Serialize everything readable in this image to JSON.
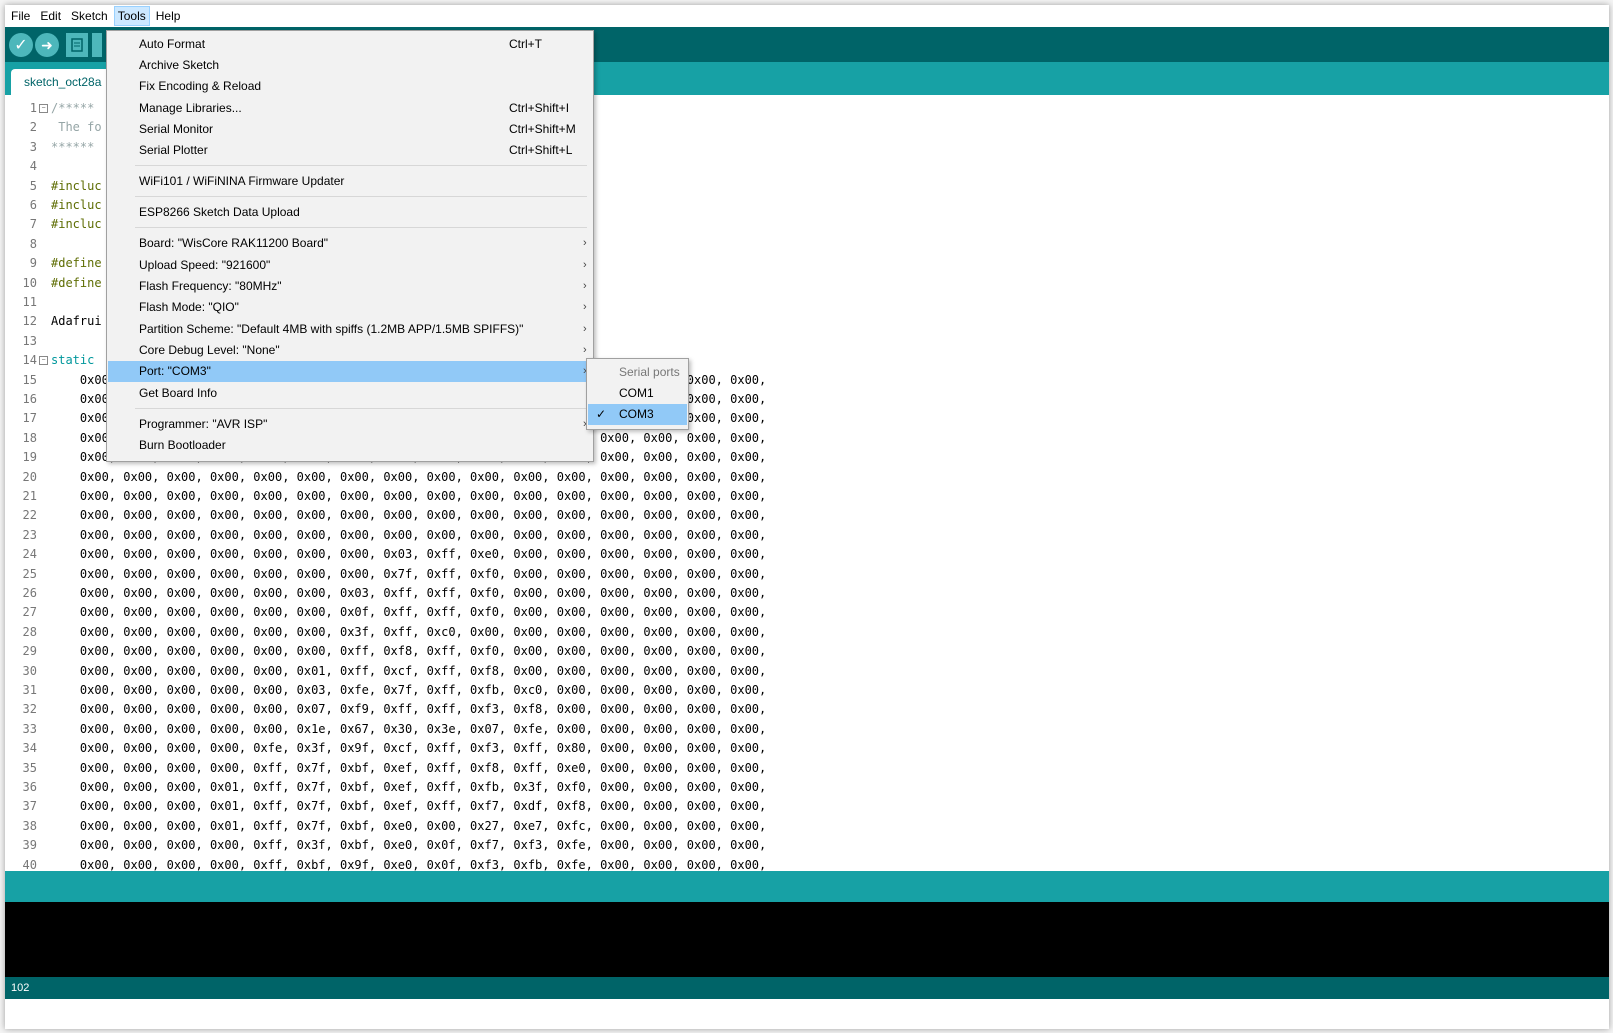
{
  "menubar": {
    "items": [
      "File",
      "Edit",
      "Sketch",
      "Tools",
      "Help"
    ]
  },
  "tab": {
    "label": "sketch_oct28a"
  },
  "editor": {
    "line_numbers": [
      "1",
      "2",
      "3",
      "4",
      "5",
      "6",
      "7",
      "8",
      "9",
      "10",
      "11",
      "12",
      "13",
      "14",
      "15",
      "16",
      "17",
      "18",
      "19",
      "20",
      "21",
      "22",
      "23",
      "24",
      "25",
      "26",
      "27",
      "28",
      "29",
      "30",
      "31",
      "32",
      "33",
      "34",
      "35",
      "36",
      "37",
      "38",
      "39",
      "40"
    ],
    "code_lines": [
      "/*****",
      " The fo",
      "******",
      "",
      "#incluc",
      "#incluc",
      "#incluc",
      "",
      "#define",
      "#define",
      "",
      "Adafrui",
      "",
      "static",
      "    0x00, 0x00, 0x00, 0x00, 0x00, 0x00, 0x00, 0x00, 0x00, 0x00, 0x00, 0x00, 0x00, 0x00, 0x00, 0x00,",
      "    0x00, 0x00, 0x00, 0x00, 0x00, 0x00, 0x00, 0x00, 0x00, 0x00, 0x00, 0x00, 0x00, 0x00, 0x00, 0x00,",
      "    0x00, 0x00, 0x00, 0x00, 0x00, 0x00, 0x00, 0x00, 0x00, 0x00, 0x00, 0x00, 0x00, 0x00, 0x00, 0x00,",
      "    0x00, 0x00, 0x00, 0x00, 0x00, 0x00, 0x00, 0x00, 0x00, 0x00, 0x00, 0x00, 0x00, 0x00, 0x00, 0x00,",
      "    0x00, 0x00, 0x00, 0x00, 0x00, 0x00, 0x00, 0x00, 0x00, 0x00, 0x00, 0x00, 0x00, 0x00, 0x00, 0x00,",
      "    0x00, 0x00, 0x00, 0x00, 0x00, 0x00, 0x00, 0x00, 0x00, 0x00, 0x00, 0x00, 0x00, 0x00, 0x00, 0x00,",
      "    0x00, 0x00, 0x00, 0x00, 0x00, 0x00, 0x00, 0x00, 0x00, 0x00, 0x00, 0x00, 0x00, 0x00, 0x00, 0x00,",
      "    0x00, 0x00, 0x00, 0x00, 0x00, 0x00, 0x00, 0x00, 0x00, 0x00, 0x00, 0x00, 0x00, 0x00, 0x00, 0x00,",
      "    0x00, 0x00, 0x00, 0x00, 0x00, 0x00, 0x00, 0x00, 0x00, 0x00, 0x00, 0x00, 0x00, 0x00, 0x00, 0x00,",
      "    0x00, 0x00, 0x00, 0x00, 0x00, 0x00, 0x00, 0x03, 0xff, 0xe0, 0x00, 0x00, 0x00, 0x00, 0x00, 0x00,",
      "    0x00, 0x00, 0x00, 0x00, 0x00, 0x00, 0x00, 0x7f, 0xff, 0xf0, 0x00, 0x00, 0x00, 0x00, 0x00, 0x00,",
      "    0x00, 0x00, 0x00, 0x00, 0x00, 0x00, 0x03, 0xff, 0xff, 0xf0, 0x00, 0x00, 0x00, 0x00, 0x00, 0x00,",
      "    0x00, 0x00, 0x00, 0x00, 0x00, 0x00, 0x0f, 0xff, 0xff, 0xf0, 0x00, 0x00, 0x00, 0x00, 0x00, 0x00,",
      "    0x00, 0x00, 0x00, 0x00, 0x00, 0x00, 0x3f, 0xff, 0xc0, 0x00, 0x00, 0x00, 0x00, 0x00, 0x00, 0x00,",
      "    0x00, 0x00, 0x00, 0x00, 0x00, 0x00, 0xff, 0xf8, 0xff, 0xf0, 0x00, 0x00, 0x00, 0x00, 0x00, 0x00,",
      "    0x00, 0x00, 0x00, 0x00, 0x00, 0x01, 0xff, 0xcf, 0xff, 0xf8, 0x00, 0x00, 0x00, 0x00, 0x00, 0x00,",
      "    0x00, 0x00, 0x00, 0x00, 0x00, 0x03, 0xfe, 0x7f, 0xff, 0xfb, 0xc0, 0x00, 0x00, 0x00, 0x00, 0x00,",
      "    0x00, 0x00, 0x00, 0x00, 0x00, 0x07, 0xf9, 0xff, 0xff, 0xf3, 0xf8, 0x00, 0x00, 0x00, 0x00, 0x00,",
      "    0x00, 0x00, 0x00, 0x00, 0x00, 0x1e, 0x67, 0x30, 0x3e, 0x07, 0xfe, 0x00, 0x00, 0x00, 0x00, 0x00,",
      "    0x00, 0x00, 0x00, 0x00, 0xfe, 0x3f, 0x9f, 0xcf, 0xff, 0xf3, 0xff, 0x80, 0x00, 0x00, 0x00, 0x00,",
      "    0x00, 0x00, 0x00, 0x00, 0xff, 0x7f, 0xbf, 0xef, 0xff, 0xf8, 0xff, 0xe0, 0x00, 0x00, 0x00, 0x00,",
      "    0x00, 0x00, 0x00, 0x01, 0xff, 0x7f, 0xbf, 0xef, 0xff, 0xfb, 0x3f, 0xf0, 0x00, 0x00, 0x00, 0x00,",
      "    0x00, 0x00, 0x00, 0x01, 0xff, 0x7f, 0xbf, 0xef, 0xff, 0xf7, 0xdf, 0xf8, 0x00, 0x00, 0x00, 0x00,",
      "    0x00, 0x00, 0x00, 0x01, 0xff, 0x7f, 0xbf, 0xe0, 0x00, 0x27, 0xe7, 0xfc, 0x00, 0x00, 0x00, 0x00,",
      "    0x00, 0x00, 0x00, 0x00, 0xff, 0x3f, 0xbf, 0xe0, 0x0f, 0xf7, 0xf3, 0xfe, 0x00, 0x00, 0x00, 0x00,",
      "    0x00, 0x00, 0x00, 0x00, 0xff, 0xbf, 0x9f, 0xe0, 0x0f, 0xf3, 0xfb, 0xfe, 0x00, 0x00, 0x00, 0x00,"
    ]
  },
  "tools_menu": {
    "items": [
      {
        "label": "Auto Format",
        "shortcut": "Ctrl+T"
      },
      {
        "label": "Archive Sketch",
        "shortcut": ""
      },
      {
        "label": "Fix Encoding & Reload",
        "shortcut": ""
      },
      {
        "label": "Manage Libraries...",
        "shortcut": "Ctrl+Shift+I"
      },
      {
        "label": "Serial Monitor",
        "shortcut": "Ctrl+Shift+M"
      },
      {
        "label": "Serial Plotter",
        "shortcut": "Ctrl+Shift+L"
      },
      {
        "label": "WiFi101 / WiFiNINA Firmware Updater",
        "shortcut": ""
      },
      {
        "label": "ESP8266 Sketch Data Upload",
        "shortcut": ""
      },
      {
        "label": "Board: \"WisCore RAK11200 Board\"",
        "shortcut": ""
      },
      {
        "label": "Upload Speed: \"921600\"",
        "shortcut": ""
      },
      {
        "label": "Flash Frequency: \"80MHz\"",
        "shortcut": ""
      },
      {
        "label": "Flash Mode: \"QIO\"",
        "shortcut": ""
      },
      {
        "label": "Partition Scheme: \"Default 4MB with spiffs (1.2MB APP/1.5MB SPIFFS)\"",
        "shortcut": ""
      },
      {
        "label": "Core Debug Level: \"None\"",
        "shortcut": ""
      },
      {
        "label": "Port: \"COM3\"",
        "shortcut": ""
      },
      {
        "label": "Get Board Info",
        "shortcut": ""
      },
      {
        "label": "Programmer: \"AVR ISP\"",
        "shortcut": ""
      },
      {
        "label": "Burn Bootloader",
        "shortcut": ""
      }
    ],
    "submenu_arrow": "›"
  },
  "port_submenu": {
    "header": "Serial ports",
    "items": [
      "COM1",
      "COM3"
    ],
    "check": "✓"
  },
  "footer": {
    "line": "102"
  },
  "toolbar": {
    "verify_glyph": "✓",
    "upload_glyph": "➜"
  },
  "colors": {
    "toolbar": "#006468",
    "tabstrip": "#17a1a5",
    "menu_highlight": "#91c9f7"
  }
}
